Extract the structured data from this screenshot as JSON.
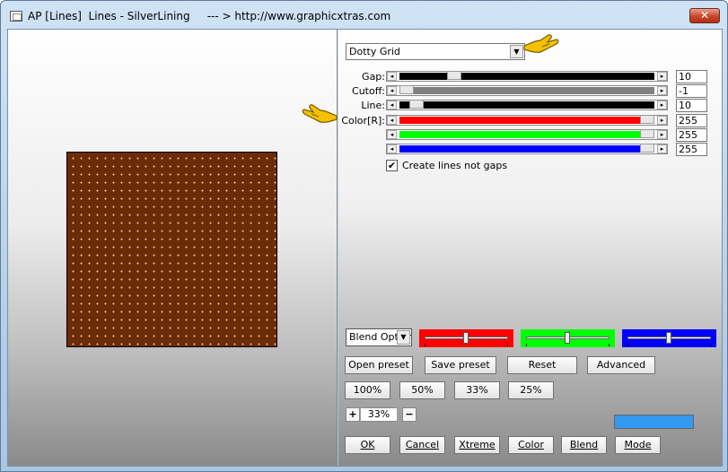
{
  "window": {
    "title": "AP [Lines]  Lines - SilverLining     --- > http://www.graphicxtras.com",
    "close_glyph": "✕"
  },
  "preset": {
    "selected": "Dotty Grid",
    "arrow": "▼"
  },
  "params": [
    {
      "label": "Gap:",
      "value": "10",
      "track_color": "#000000",
      "level": 0.19
    },
    {
      "label": "Cutoff:",
      "value": "-1",
      "track_color": "#808080",
      "level": 0.0
    },
    {
      "label": "Line:",
      "value": "10",
      "track_color": "#000000",
      "level": 0.03
    },
    {
      "label": "Color[R]:",
      "value": "255",
      "track_color": "#ff0000",
      "level": 1.0
    },
    {
      "label": "",
      "value": "255",
      "track_color": "#00ff00",
      "level": 1.0
    },
    {
      "label": "",
      "value": "255",
      "track_color": "#0000ff",
      "level": 1.0
    }
  ],
  "slider_arrows": {
    "left": "◂",
    "right": "▸"
  },
  "checkbox": {
    "checked_glyph": "✔",
    "label": "Create lines not gaps",
    "checked": true
  },
  "blend": {
    "select_value": "Blend Options",
    "arrow": "▼",
    "channels": [
      {
        "color": "#ff0000",
        "level": 0.5
      },
      {
        "color": "#00ff00",
        "level": 0.5
      },
      {
        "color": "#0000ff",
        "level": 0.5
      }
    ]
  },
  "buttons": {
    "open_preset": "Open preset",
    "save_preset": "Save preset",
    "reset": "Reset",
    "advanced": "Advanced",
    "zoom_100": "100%",
    "zoom_50": "50%",
    "zoom_33": "33%",
    "zoom_25": "25%",
    "ok": "OK",
    "cancel": "Cancel",
    "xtreme": "Xtreme",
    "color": "Color",
    "blend": "Blend",
    "mode": "Mode"
  },
  "zoom": {
    "plus": "+",
    "value": "33%",
    "minus": "−"
  },
  "colors": {
    "swatch": "#3399ee",
    "preview_bg": "#6b2b06",
    "hand": "#f2c200"
  }
}
